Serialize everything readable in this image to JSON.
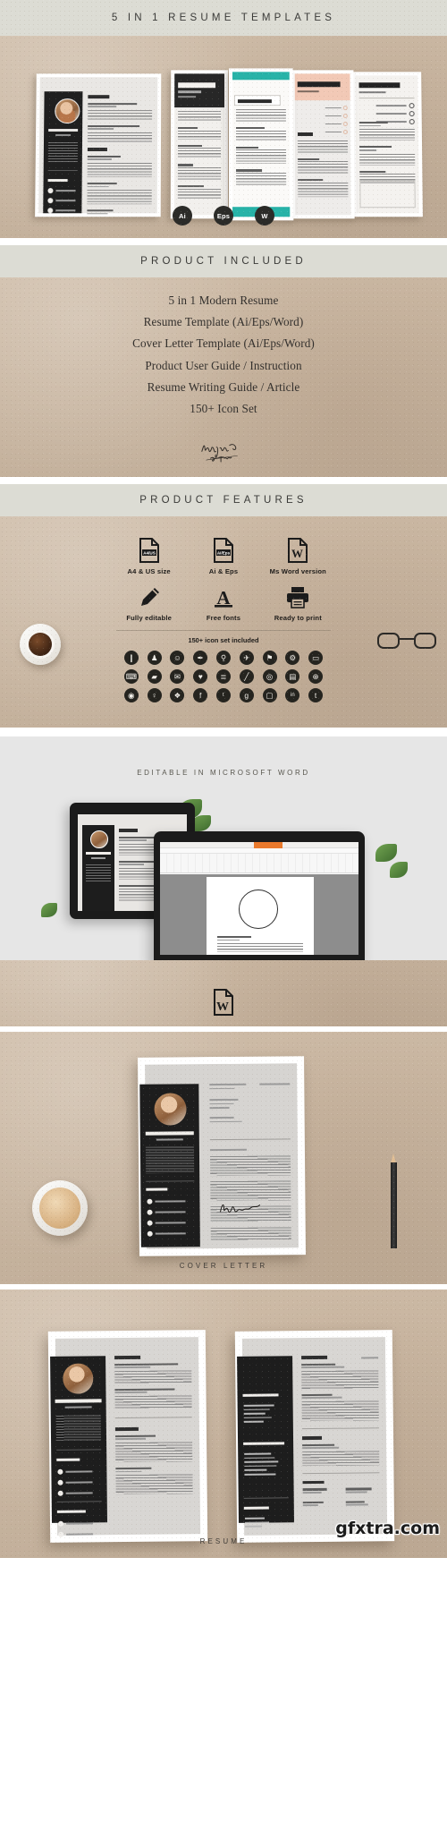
{
  "sections": {
    "hero_title": "5 IN 1 RESUME TEMPLATES",
    "product_included_title": "PRODUCT INCLUDED",
    "product_features_title": "PRODUCT FEATURES",
    "word_title": "EDITABLE IN MICROSOFT WORD",
    "cover_letter_caption": "COVER LETTER",
    "resume_caption": "RESUME"
  },
  "hero": {
    "file_pills": [
      {
        "label": "Ai"
      },
      {
        "label": "Eps"
      },
      {
        "label": "W"
      }
    ],
    "templates": [
      {
        "name": "NATALIE ALLISON",
        "role": "Content Creator",
        "headings": [
          "EDUCATION",
          "EXPERIENCE",
          "CONTACT",
          "SOCIAL MEDIA"
        ]
      },
      {
        "name": "ANNIS",
        "role": "ARCHILECT"
      },
      {
        "name": "A. SMITH",
        "role": ""
      },
      {
        "name": "HARPER",
        "role": "ACCOUNTANT"
      },
      {
        "name": "EVANS",
        "role": "WEB DEVELOPER"
      }
    ]
  },
  "product_included": {
    "items": [
      "5 in 1 Modern Resume",
      "Resume Template (Ai/Eps/Word)",
      "Cover Letter Template (Ai/Eps/Word)",
      "Product User Guide / Instruction",
      "Resume Writing Guide / Article",
      "150+ Icon Set"
    ],
    "signature_alt": "keenvisual studio"
  },
  "product_features": {
    "features": [
      {
        "label": "A4 & US size",
        "icon": "file-a4-us-icon",
        "badge": "A4/US"
      },
      {
        "label": "Ai & Eps",
        "icon": "file-ai-eps-icon",
        "badge": "Ai/Eps"
      },
      {
        "label": "Ms Word version",
        "icon": "file-word-icon",
        "badge": "W"
      },
      {
        "label": "Fully editable",
        "icon": "pencil-icon",
        "badge": ""
      },
      {
        "label": "Free fonts",
        "icon": "font-a-icon",
        "badge": "A"
      },
      {
        "label": "Ready to print",
        "icon": "printer-icon",
        "badge": ""
      }
    ],
    "icon_set_note": "150+ icon set included",
    "icon_set": [
      {
        "name": "mobile-icon",
        "glyph": "❙"
      },
      {
        "name": "user-icon",
        "glyph": "♟"
      },
      {
        "name": "contact-icon",
        "glyph": "☺"
      },
      {
        "name": "pen-icon",
        "glyph": "✒"
      },
      {
        "name": "search-user-icon",
        "glyph": "⚲"
      },
      {
        "name": "plane-icon",
        "glyph": "✈"
      },
      {
        "name": "pin-icon",
        "glyph": "⚑"
      },
      {
        "name": "gear-icon",
        "glyph": "⚙"
      },
      {
        "name": "monitor-icon",
        "glyph": "▭"
      },
      {
        "name": "gamepad-icon",
        "glyph": "⌨"
      },
      {
        "name": "folder-icon",
        "glyph": "▰"
      },
      {
        "name": "inbox-icon",
        "glyph": "✉"
      },
      {
        "name": "heart-icon",
        "glyph": "♥"
      },
      {
        "name": "stack-icon",
        "glyph": "≣"
      },
      {
        "name": "pencil-icon",
        "glyph": "╱"
      },
      {
        "name": "location-icon",
        "glyph": "◎"
      },
      {
        "name": "server-icon",
        "glyph": "▤"
      },
      {
        "name": "globe-icon",
        "glyph": "⊕"
      },
      {
        "name": "eye-icon",
        "glyph": "◉"
      },
      {
        "name": "bulb-icon",
        "glyph": "♀"
      },
      {
        "name": "share-icon",
        "glyph": "❖"
      },
      {
        "name": "facebook-icon",
        "glyph": "f"
      },
      {
        "name": "twitter-icon",
        "glyph": "ᵗ"
      },
      {
        "name": "google-plus-icon",
        "glyph": "g"
      },
      {
        "name": "instagram-icon",
        "glyph": "▢"
      },
      {
        "name": "linkedin-icon",
        "glyph": "in"
      },
      {
        "name": "tumblr-icon",
        "glyph": "t"
      }
    ]
  },
  "cover_letter": {
    "name": "NATALIE ALLISON",
    "role": "Content Creator",
    "signature_name": "NATALIE ALLISON",
    "closing": "Sincerely,",
    "headings": [
      "CONTACT",
      "SOCIAL MEDIA"
    ]
  },
  "resume_spread": {
    "page_left": {
      "name": "NATALIE ALLISON",
      "role": "Content Creator",
      "headings": [
        "EDUCATION",
        "EXPERIENCE",
        "CONTACT",
        "SOCIAL MEDIA"
      ],
      "entries": [
        "LONDON UNIVERSITY / BUSINESS MARKETING",
        "BIRMINGHAM UNIVERSITY / COMMUNICATION",
        "EVERLANE CLOTHING CO"
      ]
    },
    "page_right": {
      "headings": [
        "EXPERIENCE",
        "TECHNICAL SKILLS",
        "PROFESSIONAL SKILLS",
        "INTEREST",
        "LANGUAGE",
        "AWARDS",
        "REFERENCE"
      ],
      "technical_skills": [
        "Adobe Photoshop",
        "Adobe InDesign",
        "CorelDraw",
        "Microsoft Office",
        "Illustrator"
      ],
      "professional_skills": [
        "Storyboarding",
        "Market Research",
        "Product Development",
        "Planning & Budgeting",
        "Copy Writing",
        "Social Media Marketing"
      ],
      "entries": [
        "SERVICAL",
        "KEY DIGITAL",
        "FINANCE AWARD"
      ],
      "references": [
        "MICHAEL BERLY",
        "STEPHEN BROADSTER",
        "BILL KRABET",
        "ODIN PETTY"
      ]
    }
  },
  "watermark": {
    "text": "gfxtra.com"
  },
  "colors": {
    "kraft": "#c9b6a1",
    "band": "#dcdcd4",
    "dark": "#1d1d1d",
    "teal": "#27b3a8",
    "peach": "#f2c9b6",
    "word_orange": "#e9792c"
  }
}
